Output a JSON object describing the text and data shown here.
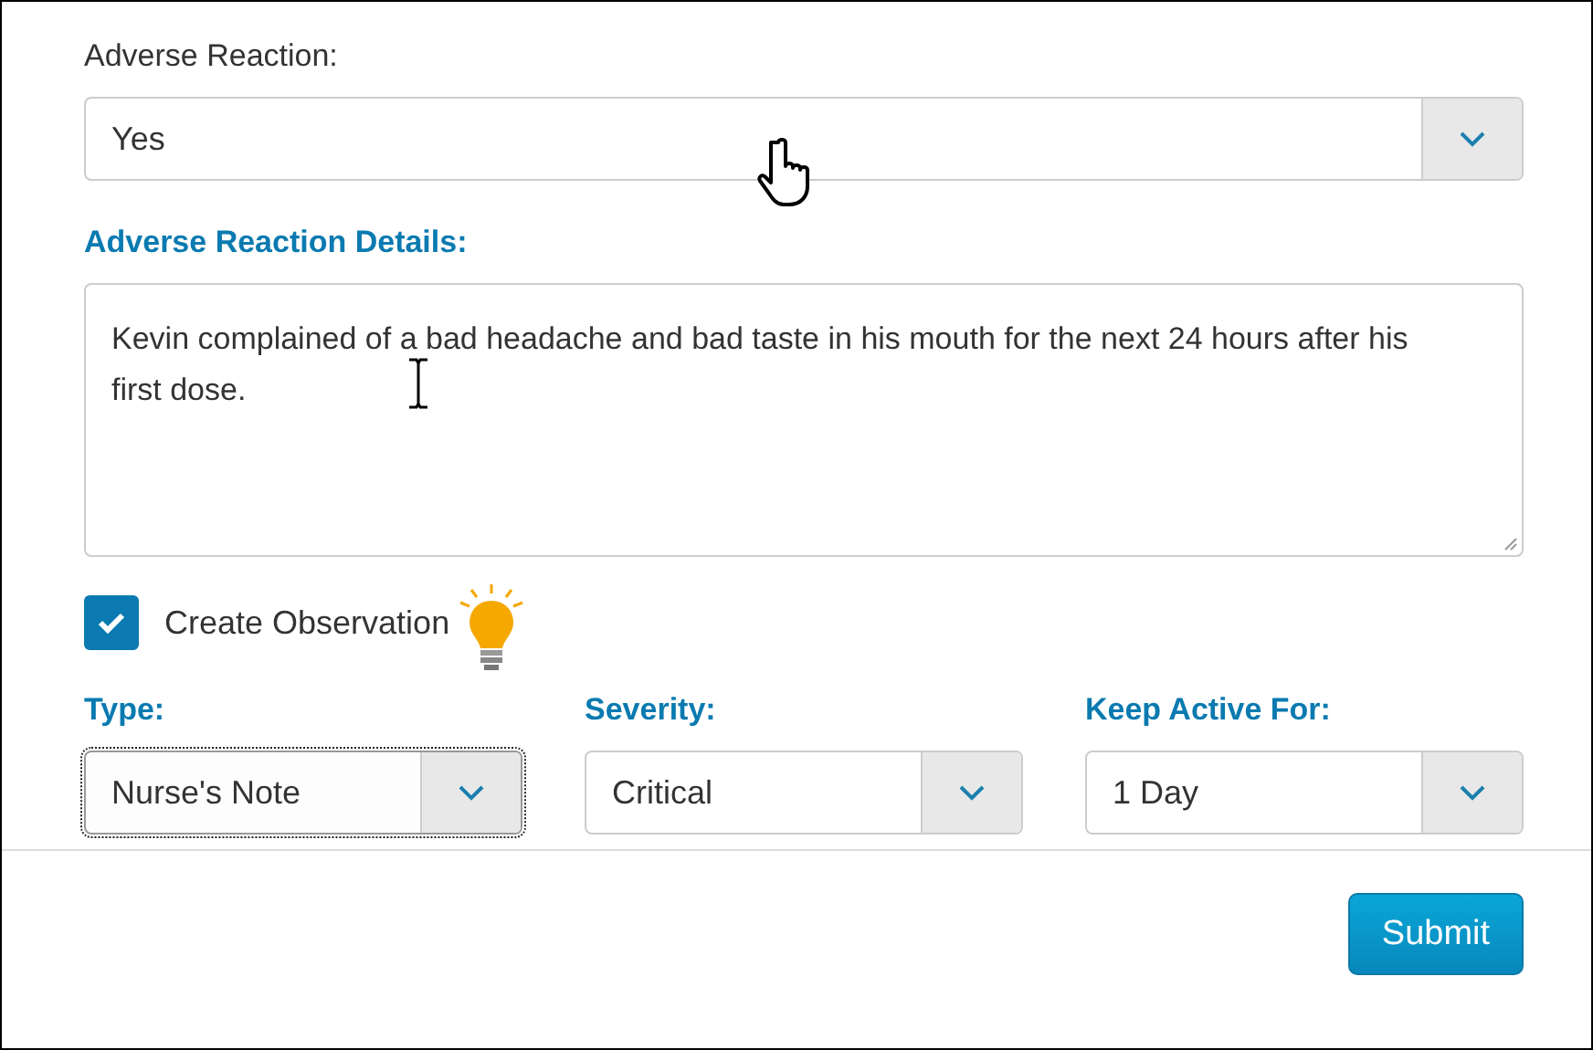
{
  "adverse_reaction": {
    "label": "Adverse Reaction:",
    "value": "Yes"
  },
  "details": {
    "label": "Adverse Reaction Details:",
    "value": "Kevin complained of a bad headache and bad taste in his mouth for the next 24 hours after his first dose."
  },
  "create_observation": {
    "label": "Create Observation",
    "checked": true
  },
  "dropdowns": [
    {
      "label": "Type:",
      "value": "Nurse's Note",
      "focused": true
    },
    {
      "label": "Severity:",
      "value": "Critical",
      "focused": false
    },
    {
      "label": "Keep Active For:",
      "value": "1 Day",
      "focused": false
    }
  ],
  "submit": "Submit"
}
